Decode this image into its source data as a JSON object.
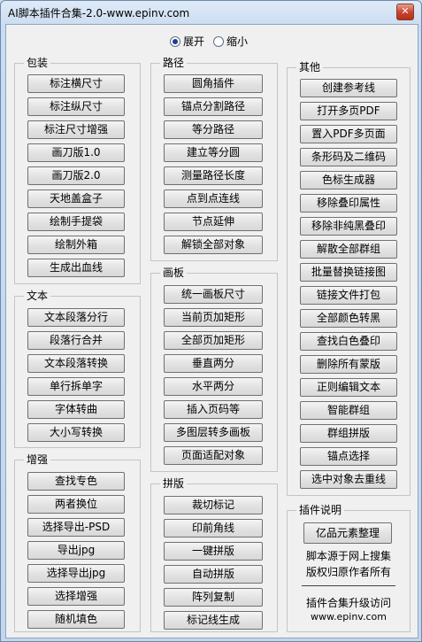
{
  "window": {
    "title": "AI脚本插件合集-2.0-www.epinv.com",
    "close_label": "✕"
  },
  "mode": {
    "expand_label": "展开",
    "collapse_label": "缩小",
    "selected": "展开"
  },
  "groups": {
    "packaging": {
      "title": "包装",
      "buttons": [
        "标注横尺寸",
        "标注纵尺寸",
        "标注尺寸增强",
        "画刀版1.0",
        "画刀版2.0",
        "天地盖盒子",
        "绘制手提袋",
        "绘制外箱",
        "生成出血线"
      ]
    },
    "text": {
      "title": "文本",
      "buttons": [
        "文本段落分行",
        "段落行合并",
        "文本段落转换",
        "单行拆单字",
        "字体转曲",
        "大小写转换"
      ]
    },
    "enhance": {
      "title": "增强",
      "buttons": [
        "查找专色",
        "两者换位",
        "选择导出-PSD",
        "导出jpg",
        "选择导出jpg",
        "选择增强",
        "随机填色"
      ]
    },
    "path": {
      "title": "路径",
      "buttons": [
        "圆角插件",
        "锚点分割路径",
        "等分路径",
        "建立等分圆",
        "测量路径长度",
        "点到点连线",
        "节点延伸",
        "解锁全部对象"
      ]
    },
    "artboard": {
      "title": "画板",
      "buttons": [
        "统一画板尺寸",
        "当前页加矩形",
        "全部页加矩形",
        "垂直两分",
        "水平两分",
        "插入页码等",
        "多图层转多画板",
        "页面适配对象"
      ]
    },
    "imposition": {
      "title": "拼版",
      "buttons": [
        "裁切标记",
        "印前角线",
        "一键拼版",
        "自动拼版",
        "阵列复制",
        "标记线生成"
      ]
    },
    "other": {
      "title": "其他",
      "buttons": [
        "创建参考线",
        "打开多页PDF",
        "置入PDF多页面",
        "条形码及二维码",
        "色标生成器",
        "移除叠印属性",
        "移除非纯黑叠印",
        "解散全部群组",
        "批量替换链接图",
        "链接文件打包",
        "全部颜色转黑",
        "查找白色叠印",
        "删除所有蒙版",
        "正则编辑文本",
        "智能群组",
        "群组拼版",
        "锚点选择",
        "选中对象去重线"
      ]
    },
    "about": {
      "title": "插件说明",
      "button": "亿品元素整理",
      "line1": "脚本源于网上搜集",
      "line2": "版权归原作者所有",
      "line3": "插件合集升级访问",
      "url": "www.epinv.com"
    }
  }
}
